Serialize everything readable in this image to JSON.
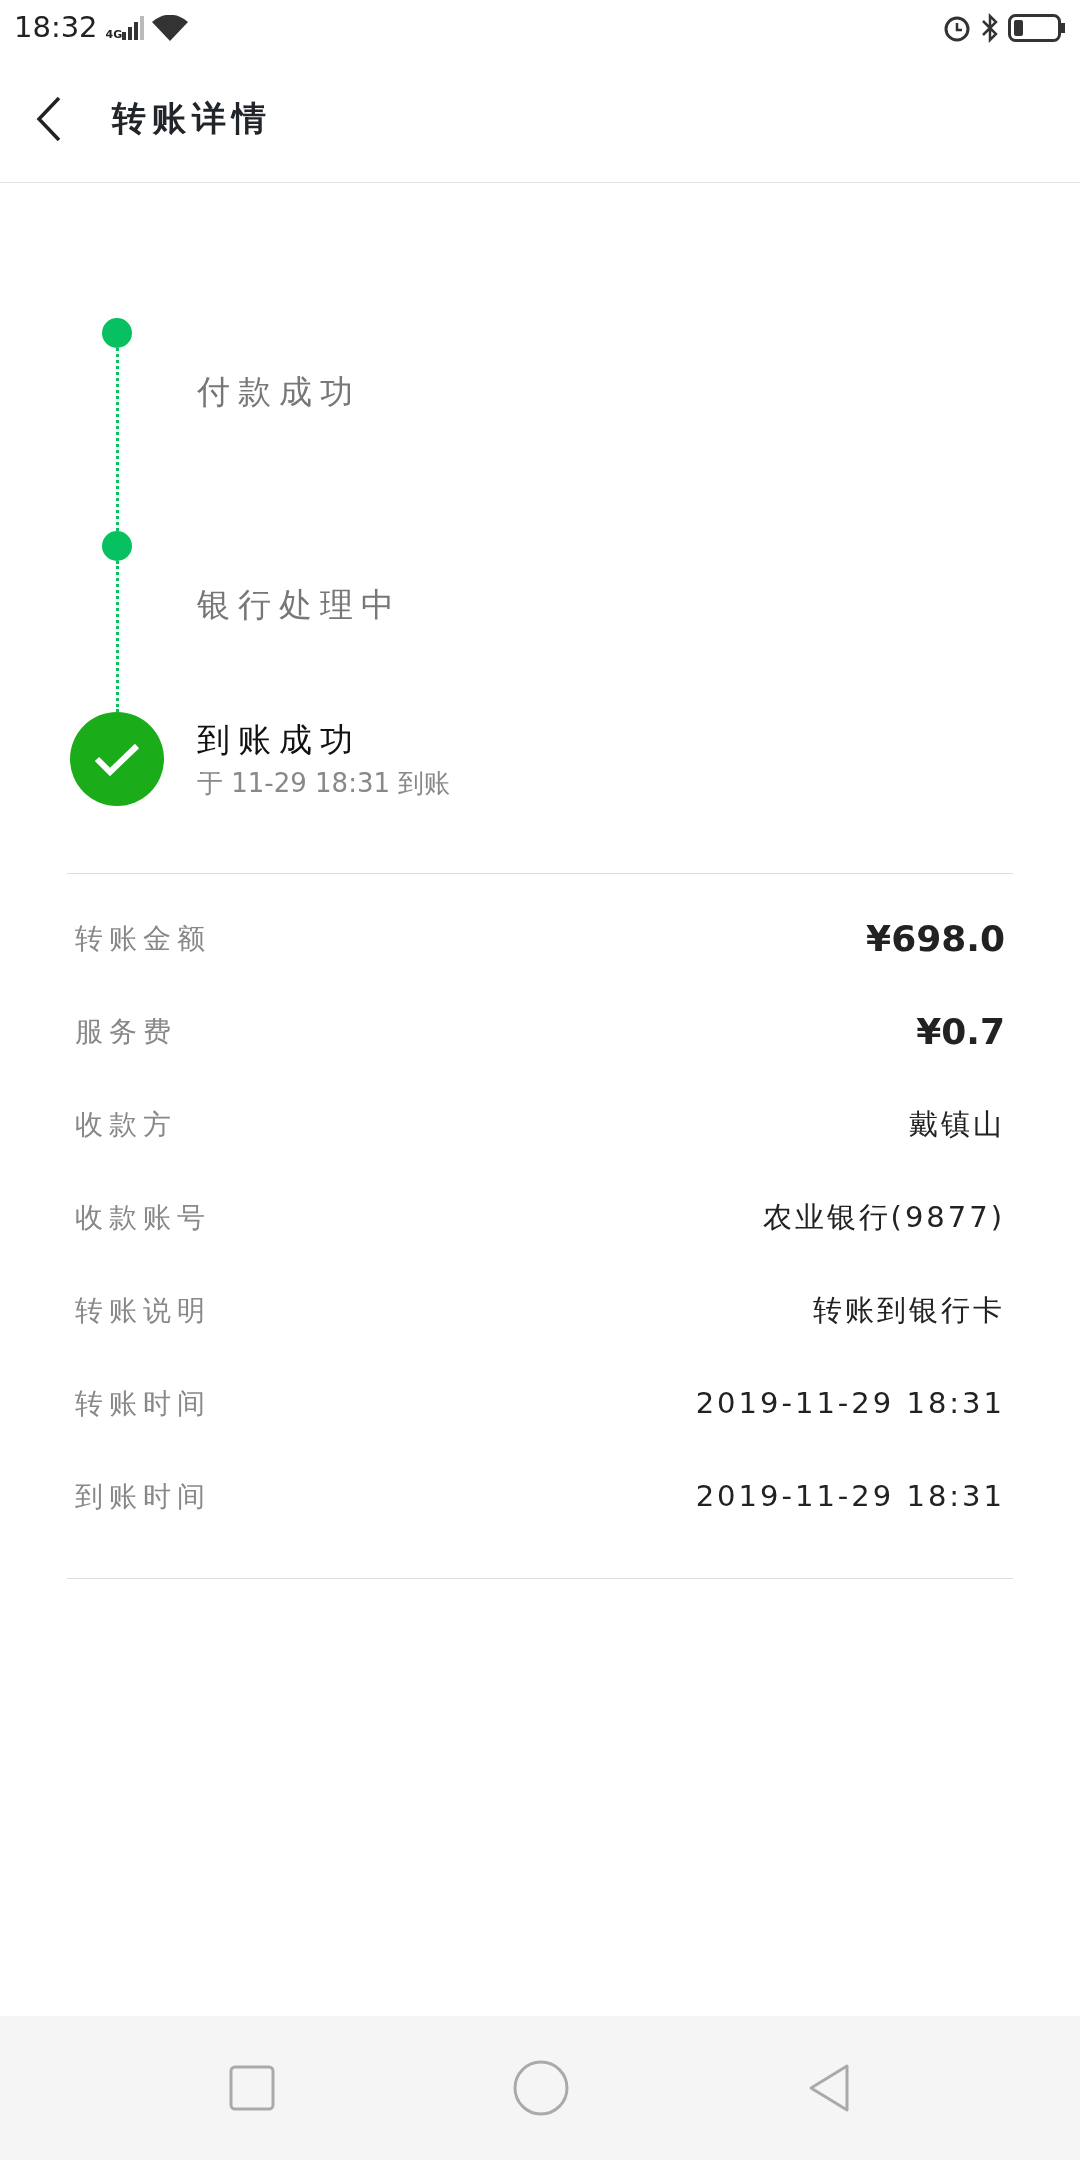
{
  "status_bar": {
    "time": "18:32",
    "network": "4G"
  },
  "header": {
    "title": "转账详情"
  },
  "steps": [
    {
      "title": "付款成功",
      "current": false
    },
    {
      "title": "银行处理中",
      "current": false
    },
    {
      "title": "到账成功",
      "current": true,
      "subtitle": "于 11-29 18:31 到账"
    }
  ],
  "details": [
    {
      "label": "转账金额",
      "value": "¥698.0",
      "emphasis": true
    },
    {
      "label": "服务费",
      "value": "¥0.7",
      "emphasis": true
    },
    {
      "label": "收款方",
      "value": "戴镇山",
      "emphasis": false
    },
    {
      "label": "收款账号",
      "value": "农业银行(9877)",
      "emphasis": false
    },
    {
      "label": "转账说明",
      "value": "转账到银行卡",
      "emphasis": false
    },
    {
      "label": "转账时间",
      "value": "2019-11-29 18:31",
      "emphasis": false
    },
    {
      "label": "到账时间",
      "value": "2019-11-29 18:31",
      "emphasis": false
    }
  ]
}
